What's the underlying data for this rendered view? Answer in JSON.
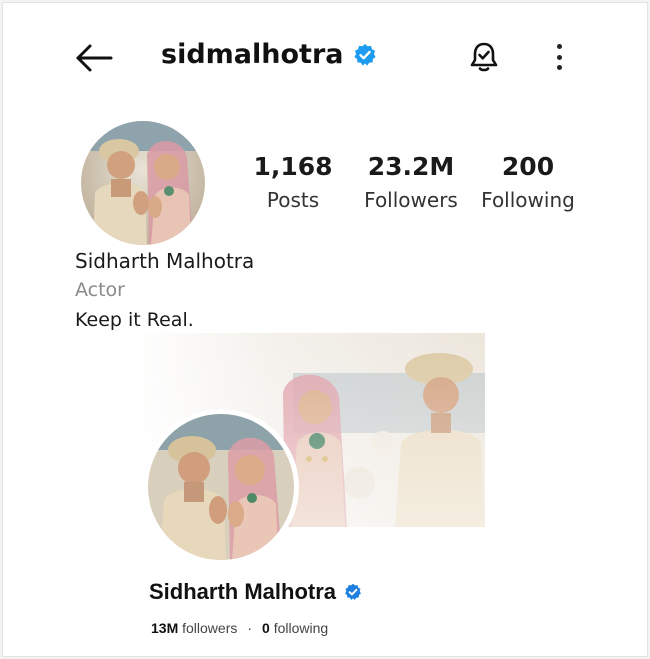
{
  "header": {
    "username": "sidmalhotra",
    "icons": [
      "back-arrow-icon",
      "verified-badge-icon",
      "notification-bell-icon",
      "more-vertical-icon"
    ],
    "badge_color": "#1d9bf0"
  },
  "profile": {
    "full_name": "Sidharth Malhotra",
    "category": "Actor",
    "bio": "Keep it Real.",
    "stats": [
      {
        "value": "1,168",
        "label": "Posts"
      },
      {
        "value": "23.2M",
        "label": "Followers"
      },
      {
        "value": "200",
        "label": "Following"
      }
    ]
  },
  "card": {
    "name": "Sidharth Malhotra",
    "followers_count": "13M",
    "followers_label": "followers",
    "separator": "·",
    "following_count": "0",
    "following_label": "following"
  }
}
